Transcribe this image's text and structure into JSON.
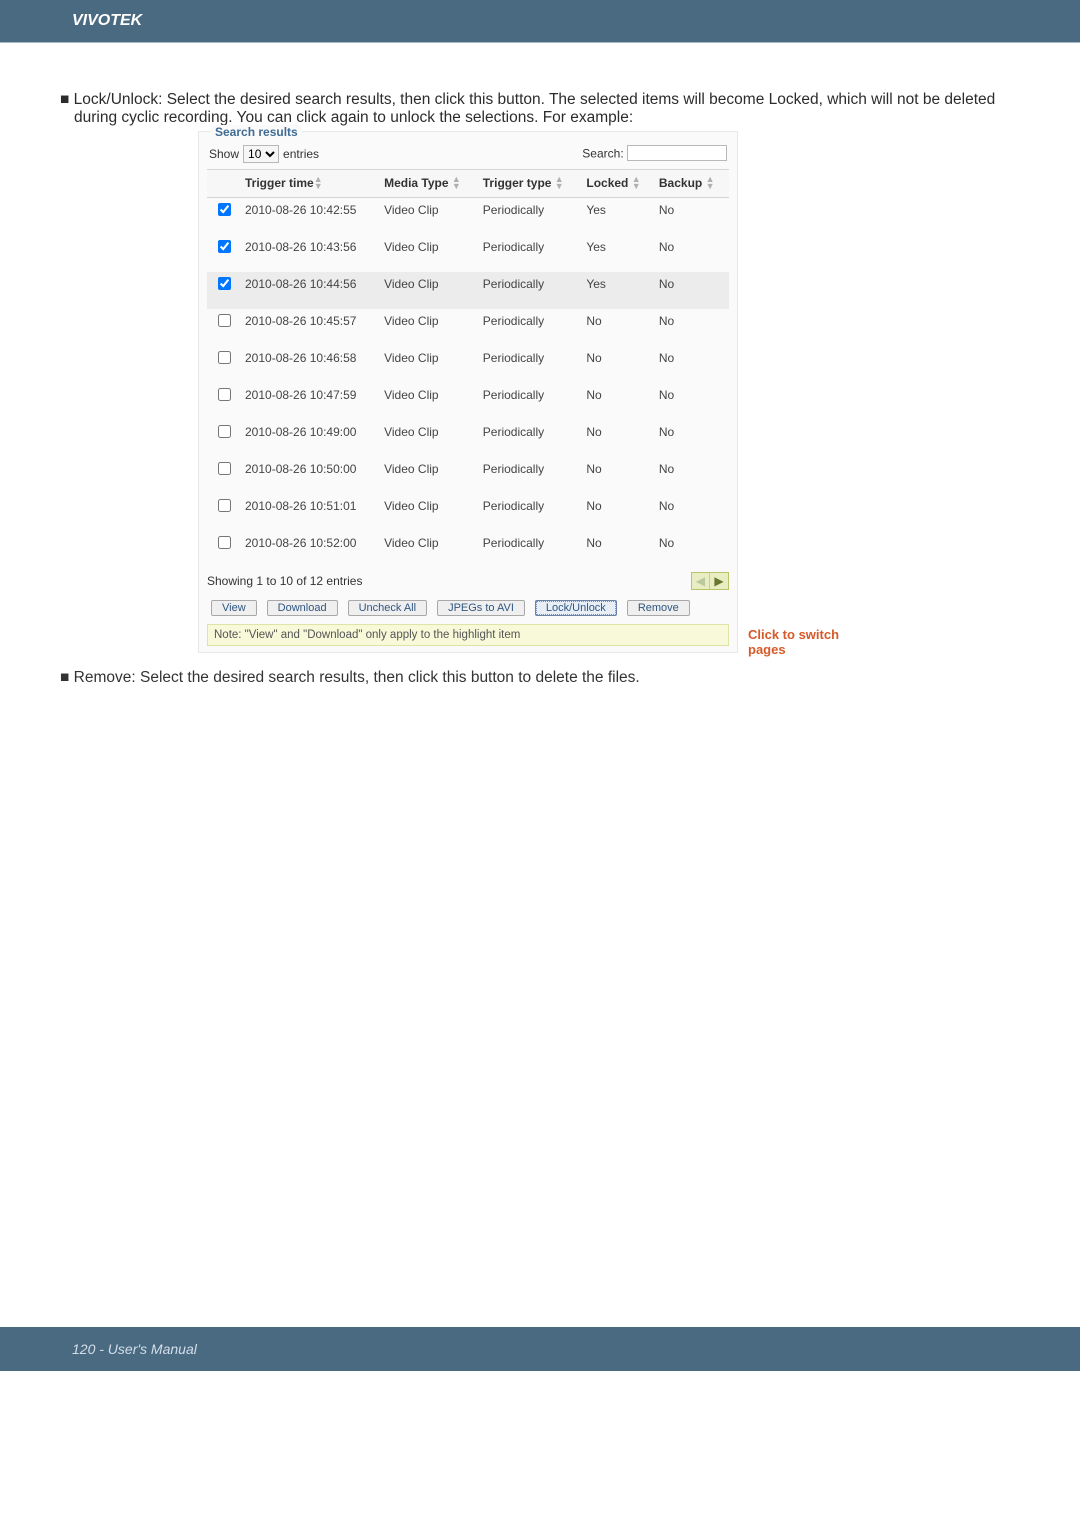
{
  "header": {
    "brand": "VIVOTEK"
  },
  "body": {
    "para_lock": "■ Lock/Unlock: Select the desired search results, then click this button. The selected items will become Locked, which will not be deleted during cyclic recording. You can click again to unlock the selections. For example:",
    "para_remove": "■ Remove: Select the desired search results, then click this button to delete the files."
  },
  "screenshot": {
    "legend": "Search results",
    "show_label": "Show",
    "entries_value": "10",
    "entries_suffix": "entries",
    "search_label": "Search:",
    "columns": {
      "time": "Trigger time",
      "media": "Media Type",
      "type": "Trigger type",
      "locked": "Locked",
      "backup": "Backup"
    },
    "rows": [
      {
        "checked": true,
        "highlight": false,
        "time": "2010-08-26 10:42:55",
        "media": "Video Clip",
        "type": "Periodically",
        "locked": "Yes",
        "backup": "No"
      },
      {
        "checked": true,
        "highlight": false,
        "time": "2010-08-26 10:43:56",
        "media": "Video Clip",
        "type": "Periodically",
        "locked": "Yes",
        "backup": "No"
      },
      {
        "checked": true,
        "highlight": true,
        "time": "2010-08-26 10:44:56",
        "media": "Video Clip",
        "type": "Periodically",
        "locked": "Yes",
        "backup": "No"
      },
      {
        "checked": false,
        "highlight": false,
        "time": "2010-08-26 10:45:57",
        "media": "Video Clip",
        "type": "Periodically",
        "locked": "No",
        "backup": "No"
      },
      {
        "checked": false,
        "highlight": false,
        "time": "2010-08-26 10:46:58",
        "media": "Video Clip",
        "type": "Periodically",
        "locked": "No",
        "backup": "No"
      },
      {
        "checked": false,
        "highlight": false,
        "time": "2010-08-26 10:47:59",
        "media": "Video Clip",
        "type": "Periodically",
        "locked": "No",
        "backup": "No"
      },
      {
        "checked": false,
        "highlight": false,
        "time": "2010-08-26 10:49:00",
        "media": "Video Clip",
        "type": "Periodically",
        "locked": "No",
        "backup": "No"
      },
      {
        "checked": false,
        "highlight": false,
        "time": "2010-08-26 10:50:00",
        "media": "Video Clip",
        "type": "Periodically",
        "locked": "No",
        "backup": "No"
      },
      {
        "checked": false,
        "highlight": false,
        "time": "2010-08-26 10:51:01",
        "media": "Video Clip",
        "type": "Periodically",
        "locked": "No",
        "backup": "No"
      },
      {
        "checked": false,
        "highlight": false,
        "time": "2010-08-26 10:52:00",
        "media": "Video Clip",
        "type": "Periodically",
        "locked": "No",
        "backup": "No"
      }
    ],
    "showing": "Showing 1 to 10 of 12 entries",
    "buttons": {
      "view": "View",
      "download": "Download",
      "uncheck": "Uncheck All",
      "jpegs": "JPEGs to AVI",
      "lock": "Lock/Unlock",
      "remove": "Remove"
    },
    "note": "Note: \"View\" and \"Download\" only apply to the highlight item"
  },
  "annotation": {
    "switch_pages": "Click to switch pages"
  },
  "footer": {
    "page_label": "120 - User's Manual"
  }
}
